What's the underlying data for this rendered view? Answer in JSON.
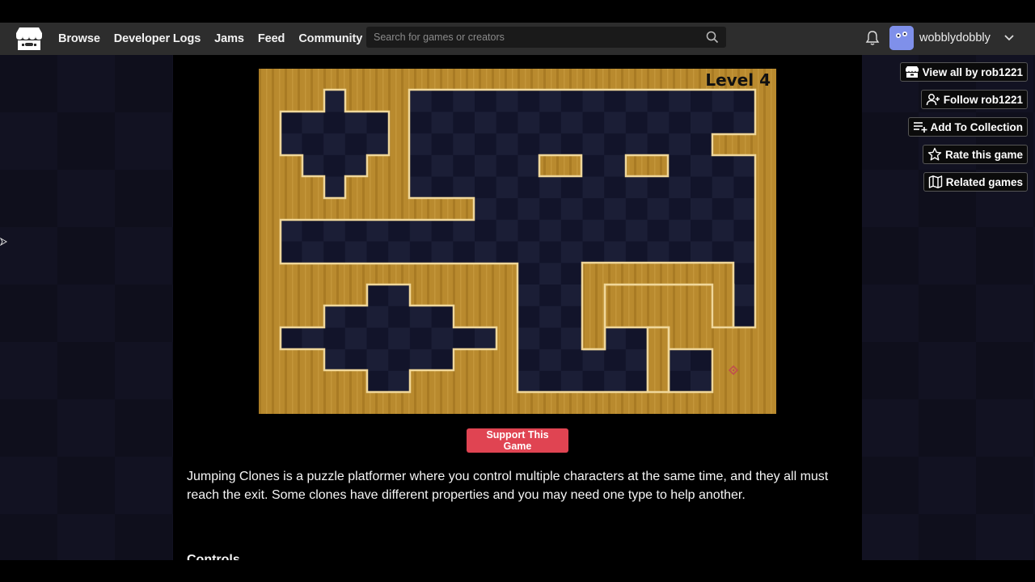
{
  "header": {
    "nav": [
      "Browse",
      "Developer Logs",
      "Jams",
      "Feed",
      "Community"
    ],
    "search_placeholder": "Search for games or creators",
    "username": "wobblydobbly"
  },
  "actions": [
    {
      "icon": "itch-store-icon",
      "label": "View all by rob1221"
    },
    {
      "icon": "user-plus-icon",
      "label": "Follow rob1221"
    },
    {
      "icon": "playlist-add-icon",
      "label": "Add To Collection"
    },
    {
      "icon": "star-icon",
      "label": "Rate this game"
    },
    {
      "icon": "map-icon",
      "label": "Related games"
    }
  ],
  "game": {
    "level_label": "Level 4",
    "colors": {
      "wall": "#b98a2e",
      "wall_stripe": "#a97b24",
      "edge": "#f0d79a",
      "floor_a": "#12142a",
      "floor_b": "#1c1f38"
    }
  },
  "support_label": "Support This Game",
  "description": "Jumping Clones is a puzzle platformer where you control multiple characters at the same time, and they all must reach the exit. Some clones have different properties and you may need one type to help another.",
  "controls_heading": "Controls"
}
